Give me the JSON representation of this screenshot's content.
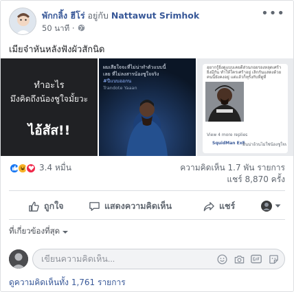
{
  "post": {
    "author_name": "พักกลิ้ง ฮีโร่",
    "with_text": "อยู่กับ",
    "tagged_name": "Nattawut Srimhok",
    "time_text": "50 นาที ·",
    "body_text": "เมียจ๋าหันหลังฟังผัวสักนิด"
  },
  "photos": {
    "photo1": {
      "line1": "ทำอะไร",
      "line2": "มึงคิดถึงน้องชูใจมั้ยวะ",
      "line3": "ไอ้สัส!!"
    },
    "photo2": {
      "caption": "ผมเสียใจจะที่ไม่น่าทำตัวแบบนี้เลย ที่ไม่ลงสารน้องชูใจจริง",
      "hashtag": "#ปีแบบออกน",
      "username": "Trandote Yaaan"
    },
    "photo3": {
      "top_text": "อยากรู้ยิ่งดูแบบเคยดีส่วนกอยรองหลุดเศร้ายิ่งมีกัน ทำให้ใครเศร้าอยู่ เลิกกันแสดงด้วยคนนี้ยังคงอยู่ แต่แล้วก็ทุรังกับที่ดูที่",
      "reply_label": "View 4 more replies",
      "commenter": "SquidMan ExE",
      "reply_text": "มันน่าอ้วนไม่ใช่น้องชูใจหน้า"
    }
  },
  "stats": {
    "reactions_count": "3.4 หมื่น",
    "comments_count": "ความคิดเห็น 1.7 พัน รายการ",
    "shares_count": "แชร์ 8,870 ครั้ง"
  },
  "actions": {
    "like_label": "ถูกใจ",
    "comment_label": "แสดงความคิดเห็น",
    "share_label": "แชร์"
  },
  "comments": {
    "sort_label": "ที่เกี่ยวข้องที่สุด",
    "input_placeholder": "เขียนความคิดเห็น...",
    "view_more_label": "ดูความคิดเห็นทั้ง 1,761 รายการ"
  },
  "colors": {
    "link_blue": "#385898",
    "like_blue": "#1877f2",
    "haha_yellow": "#f7b125",
    "love_red": "#f0284a",
    "secondary_text": "#606770"
  },
  "icons": [
    "globe-icon",
    "more-icon",
    "like-reaction-icon",
    "haha-reaction-icon",
    "love-reaction-icon",
    "thumbs-up-icon",
    "comment-icon",
    "share-icon",
    "emoji-icon",
    "camera-icon",
    "gif-icon",
    "sticker-icon",
    "chevron-down-icon"
  ]
}
